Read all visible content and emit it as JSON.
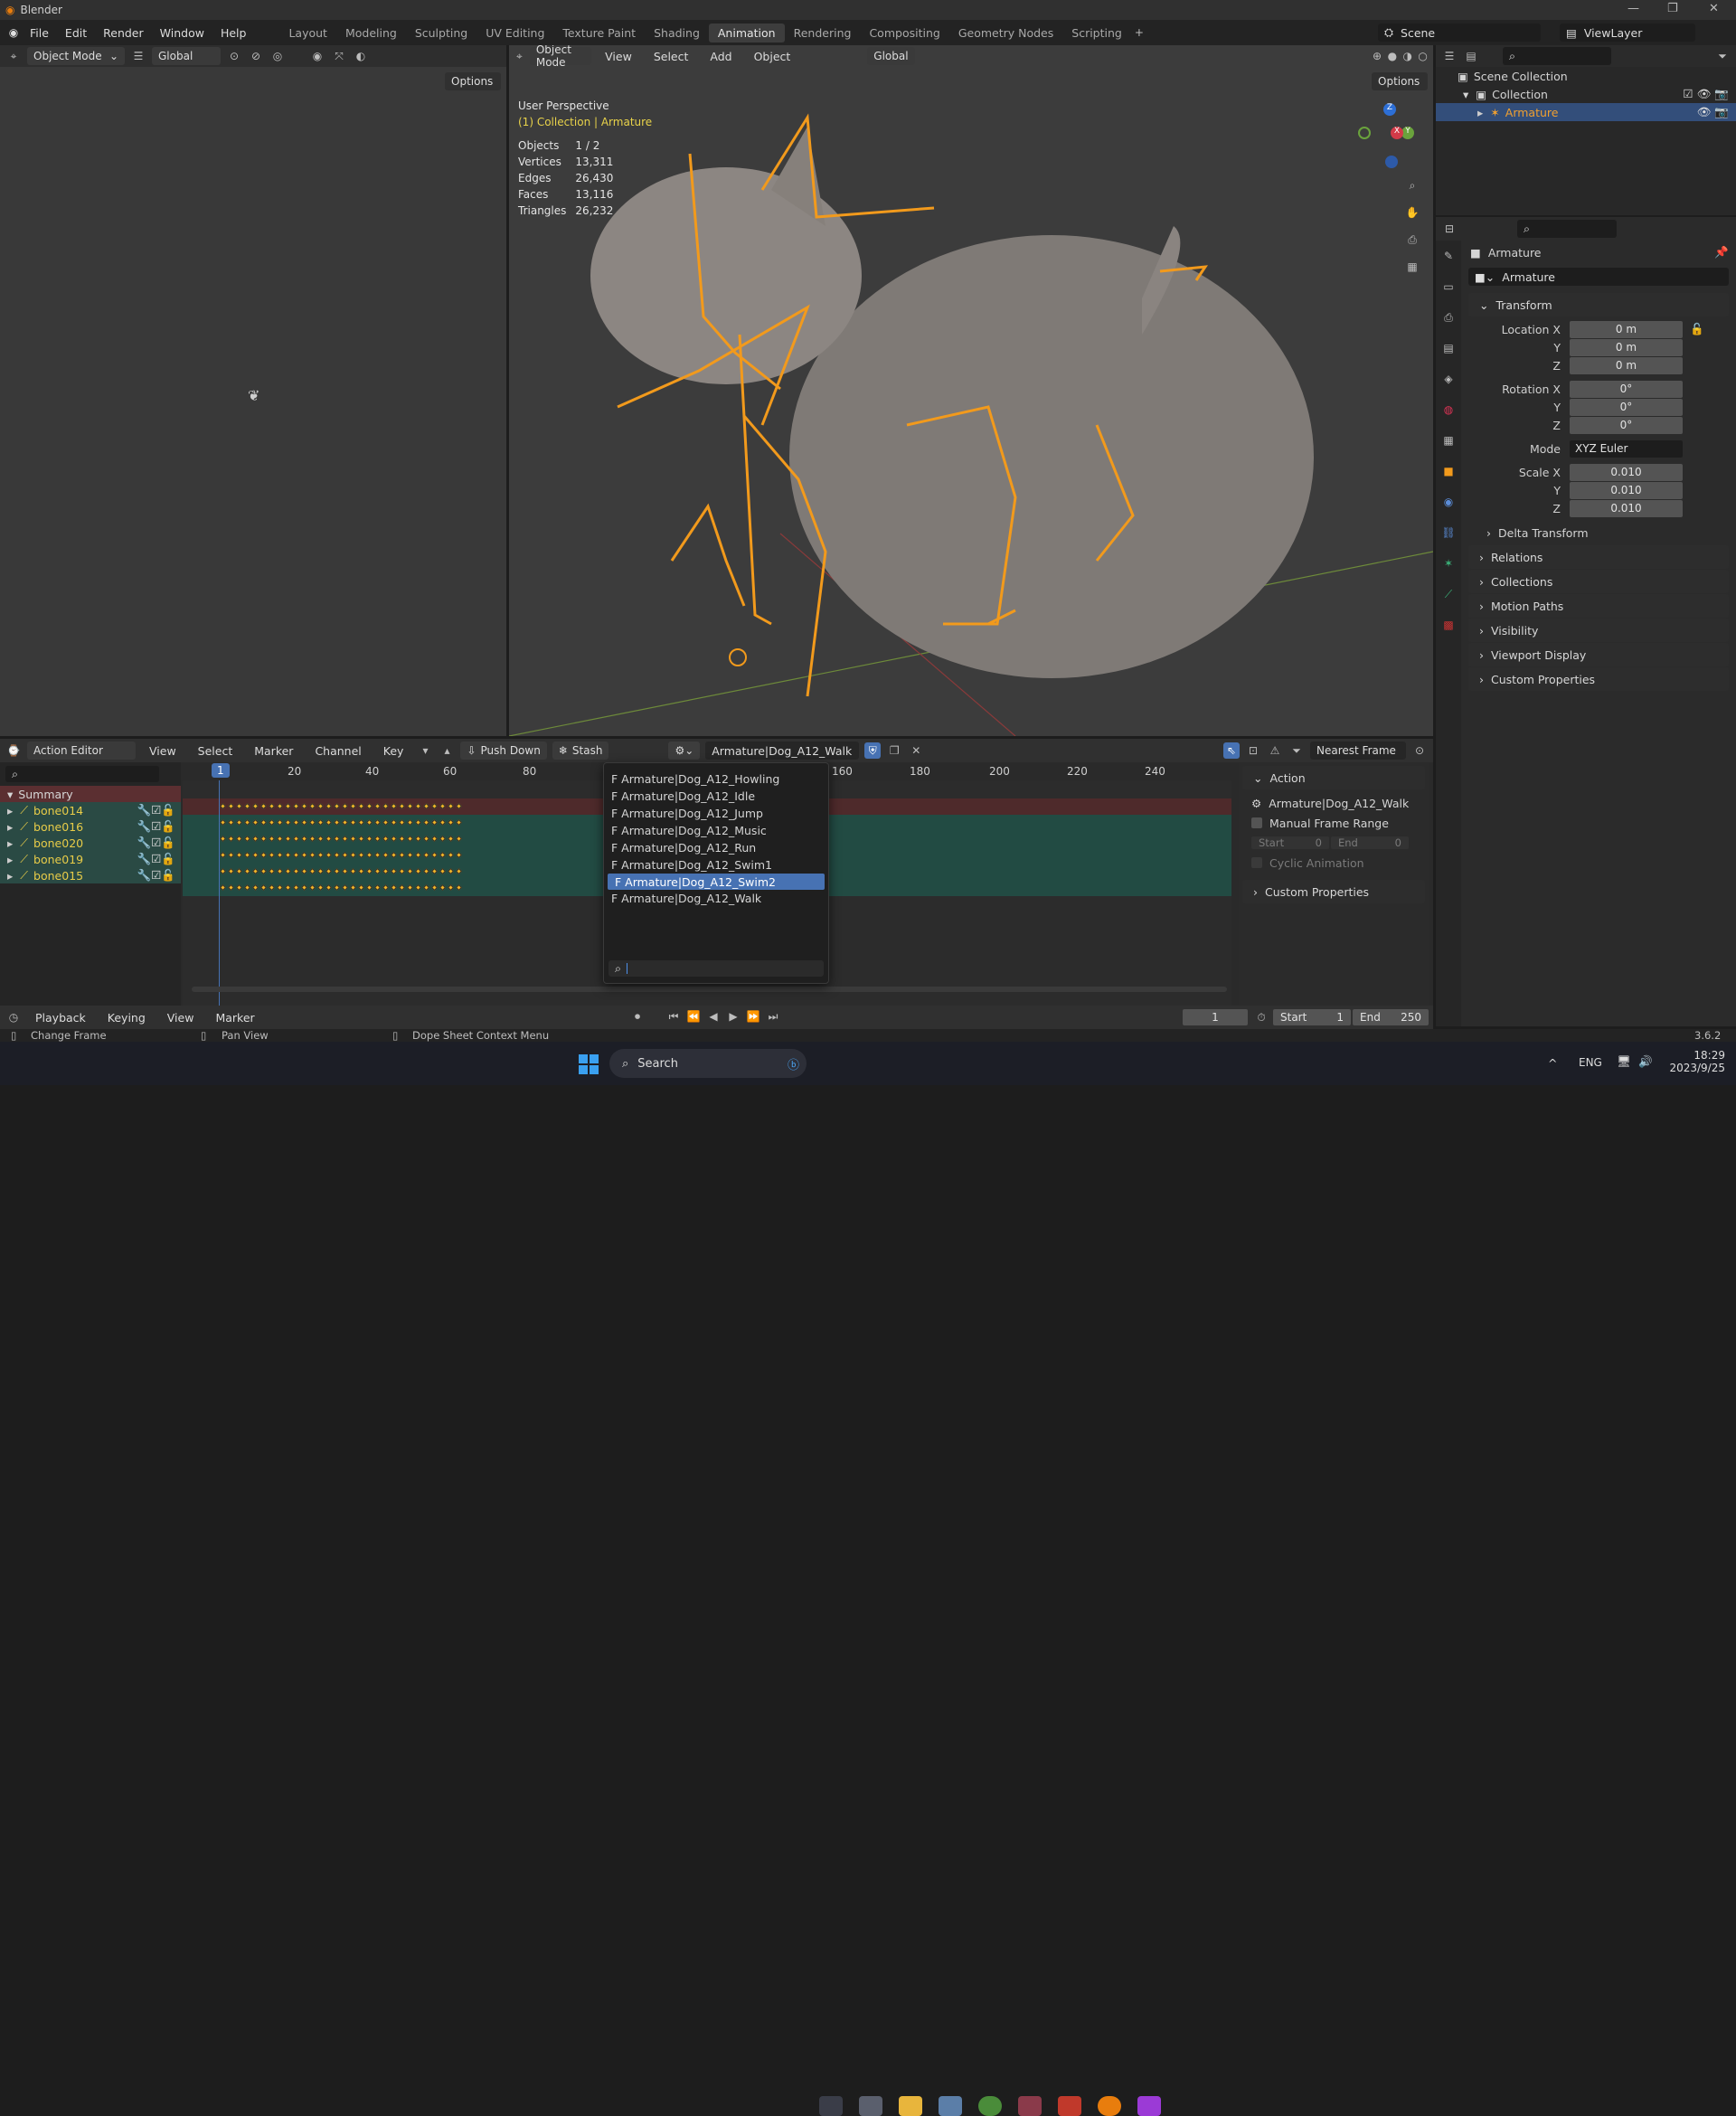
{
  "app": {
    "title": "Blender",
    "version": "3.6.2"
  },
  "menus": [
    "File",
    "Edit",
    "Render",
    "Window",
    "Help"
  ],
  "workspaces": [
    "Layout",
    "Modeling",
    "Sculpting",
    "UV Editing",
    "Texture Paint",
    "Shading",
    "Animation",
    "Rendering",
    "Compositing",
    "Geometry Nodes",
    "Scripting"
  ],
  "active_workspace": "Animation",
  "scene": {
    "name": "Scene",
    "view_layer": "ViewLayer"
  },
  "left_viewport": {
    "mode": "Object Mode",
    "orientation": "Global",
    "options": "Options"
  },
  "main_viewport": {
    "mode": "Object Mode",
    "menus": [
      "View",
      "Select",
      "Add",
      "Object"
    ],
    "orientation": "Global",
    "options": "Options",
    "perspective": "User Perspective",
    "collection": "(1) Collection | Armature",
    "stats": [
      {
        "k": "Objects",
        "v": "1 / 2"
      },
      {
        "k": "Vertices",
        "v": "13,311"
      },
      {
        "k": "Edges",
        "v": "26,430"
      },
      {
        "k": "Faces",
        "v": "13,116"
      },
      {
        "k": "Triangles",
        "v": "26,232"
      }
    ]
  },
  "outliner": {
    "scene_collection": "Scene Collection",
    "collection": "Collection",
    "armature": "Armature"
  },
  "properties": {
    "object_name": "Armature",
    "data_name": "Armature",
    "transform": "Transform",
    "location": {
      "label": "Location X",
      "x": "0 m",
      "y": "0 m",
      "z": "0 m"
    },
    "rotation": {
      "label": "Rotation X",
      "x": "0°",
      "y": "0°",
      "z": "0°"
    },
    "mode_label": "Mode",
    "mode": "XYZ Euler",
    "scale": {
      "label": "Scale X",
      "x": "0.010",
      "y": "0.010",
      "z": "0.010"
    },
    "axis_y": "Y",
    "axis_z": "Z",
    "delta": "Delta Transform",
    "sections": [
      "Relations",
      "Collections",
      "Motion Paths",
      "Visibility",
      "Viewport Display",
      "Custom Properties"
    ]
  },
  "action_editor": {
    "editor": "Action Editor",
    "menus": [
      "View",
      "Select",
      "Marker",
      "Channel",
      "Key"
    ],
    "push_down": "Push Down",
    "stash": "Stash",
    "action": "Armature|Dog_A12_Walk",
    "snap": "Nearest Frame",
    "ruler": [
      "1",
      "20",
      "40",
      "60",
      "80",
      "160",
      "180",
      "200",
      "220",
      "240"
    ],
    "summary": "Summary",
    "channels": [
      "bone014",
      "bone016",
      "bone020",
      "bone019",
      "bone015"
    ],
    "dropdown": [
      "F Armature|Dog_A12_Howling",
      "F Armature|Dog_A12_Idle",
      "F Armature|Dog_A12_Jump",
      "F Armature|Dog_A12_Music",
      "F Armature|Dog_A12_Run",
      "F Armature|Dog_A12_Swim1",
      "F Armature|Dog_A12_Swim2",
      "F Armature|Dog_A12_Walk"
    ],
    "dropdown_selected_index": 6,
    "side": {
      "title": "Action",
      "action": "Armature|Dog_A12_Walk",
      "manual": "Manual Frame Range",
      "start_label": "Start",
      "start": "0",
      "end_label": "End",
      "end": "0",
      "cyclic": "Cyclic Animation",
      "custom": "Custom Properties"
    }
  },
  "timeline": {
    "menus": [
      "Playback",
      "Keying",
      "View",
      "Marker"
    ],
    "current_frame": "1",
    "start_label": "Start",
    "start": "1",
    "end_label": "End",
    "end": "250"
  },
  "status": {
    "change_frame": "Change Frame",
    "pan_view": "Pan View",
    "context_menu": "Dope Sheet Context Menu"
  },
  "taskbar": {
    "search": "Search",
    "lang": "ENG",
    "time": "18:29",
    "date": "2023/9/25"
  }
}
